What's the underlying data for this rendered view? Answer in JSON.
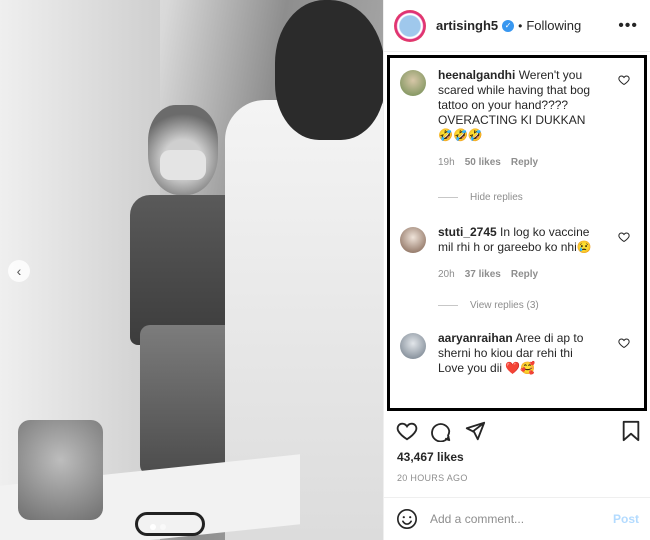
{
  "post": {
    "username": "artisingh5",
    "verified": true,
    "separator": "•",
    "follow_status": "Following",
    "more_icon": "more-horizontal-icon",
    "likes": "43,467 likes",
    "timestamp": "20 HOURS AGO"
  },
  "comments": [
    {
      "username": "heenalgandhi",
      "text": "Weren't you scared while having that bog tattoo on your hand???? OVERACTING KI DUKKAN 🤣🤣🤣",
      "time": "19h",
      "likes": "50 likes",
      "reply": "Reply",
      "replies_label": "Hide replies",
      "avatar_color": "#8fa86b"
    },
    {
      "username": "stuti_2745",
      "text": "In log ko vaccine mil rhi h or gareebo ko nhi😢",
      "time": "20h",
      "likes": "37 likes",
      "reply": "Reply",
      "replies_label": "View replies (3)",
      "avatar_color": "#c9b6a8"
    },
    {
      "username": "aaryanraihan",
      "text": "Aree di ap to sherni ho kiou dar rehi thi Love you dii ❤️🥰",
      "avatar_color": "#b9c2cc"
    }
  ],
  "add_comment": {
    "placeholder": "Add a comment...",
    "post_label": "Post"
  },
  "colors": {
    "verified": "#3897f0",
    "post_button": "#b3dbff",
    "highlight_border": "#000000"
  }
}
